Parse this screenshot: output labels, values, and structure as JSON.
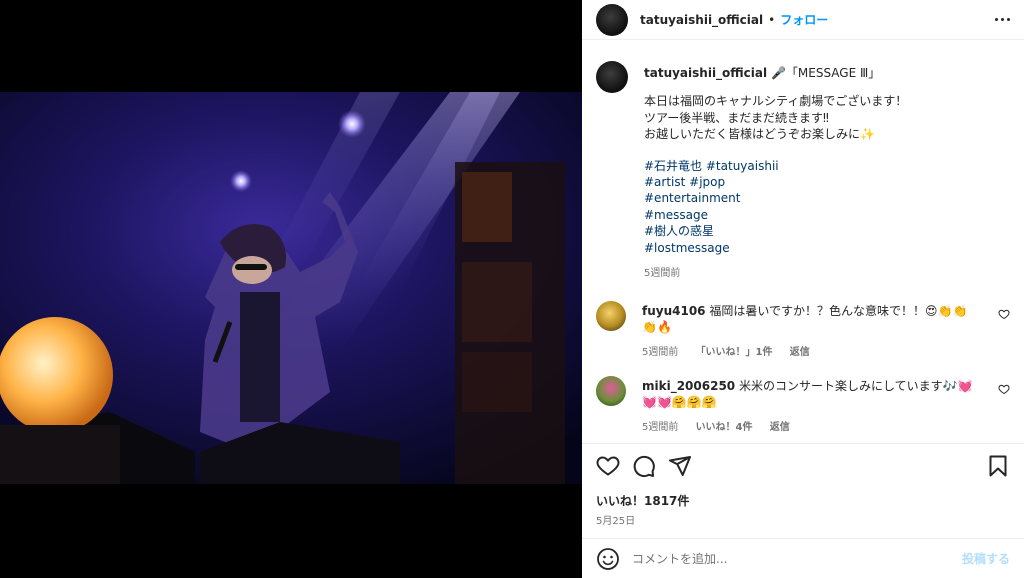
{
  "header": {
    "username": "tatuyaishii_official",
    "separator": "•",
    "follow_label": "フォロー"
  },
  "caption": {
    "username": "tatuyaishii_official",
    "title": "🎤「MESSAGE Ⅲ」",
    "lines": [
      "本日は福岡のキャナルシティ劇場でございます！",
      "ツアー後半戦、まだまだ続きます‼︎",
      "お越しいただく皆様はどうぞお楽しみに✨"
    ],
    "hashtags": [
      "#石井竜也 #tatuyaishii",
      "#artist #jpop",
      "#entertainment",
      "#message",
      "#樹人の惑星",
      "#lostmessage"
    ],
    "time": "5週間前"
  },
  "comments": [
    {
      "username": "fuyu4106",
      "text": "福岡は暑いですか！？色んな意味で！！😍👏👏👏🔥",
      "time": "5週間前",
      "likes": "「いいね！」1件",
      "reply": "返信",
      "avatar_color": "#d9b53a"
    },
    {
      "username": "miki_2006250",
      "text": "米米のコンサート楽しみにしています🎶💓💓💓🤗🤗🤗",
      "time": "5週間前",
      "likes": "いいね！4件",
      "reply": "返信",
      "avatar_color": "#5c7a3a"
    }
  ],
  "actions": {
    "icons": [
      "heart-icon",
      "comment-icon",
      "share-icon",
      "bookmark-icon"
    ],
    "likes": "いいね！1817件",
    "date": "5月25日"
  },
  "add_comment": {
    "placeholder": "コメントを追加...",
    "post_label": "投稿する"
  },
  "colors": {
    "link": "#00376b",
    "follow": "#0095f6",
    "muted": "#737373",
    "post_disabled": "#b2dffc"
  }
}
